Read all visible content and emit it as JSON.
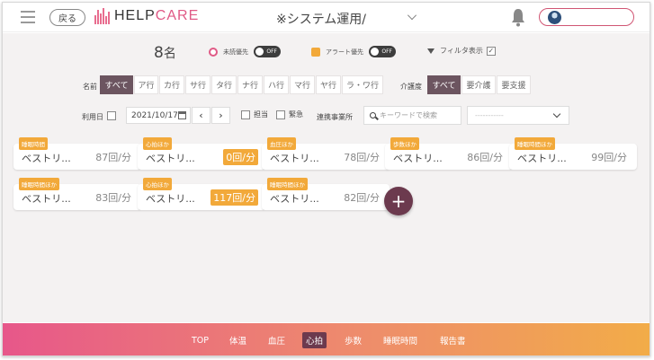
{
  "header": {
    "back_label": "戻る",
    "logo_text_1": "HELP",
    "logo_text_2": "CARE",
    "title": "※システム運用/",
    "menu_icon": "hamburger-menu-icon",
    "bell_icon": "bell-icon",
    "dropdown_icon": "chevron-down-icon"
  },
  "toolbar": {
    "count_number": "8",
    "count_unit": "名",
    "unread_label": "未読優先",
    "unread_toggle": "OFF",
    "alert_label": "アラート優先",
    "alert_toggle": "OFF",
    "filter_label": "フィルタ表示",
    "filter_checked": "✓"
  },
  "filters": {
    "name_label": "名前",
    "name_options": [
      "すべて",
      "ア行",
      "カ行",
      "サ行",
      "タ行",
      "ナ行",
      "ハ行",
      "マ行",
      "ヤ行",
      "ラ・ワ行"
    ],
    "care_label": "介護度",
    "care_options": [
      "すべて",
      "要介護",
      "要支援"
    ],
    "usage_label": "利用日",
    "date_value": "2021/10/17",
    "prev_label": "‹",
    "next_label": "›",
    "assigned_label": "担当",
    "urgent_label": "緊急",
    "office_label": "連携事業所",
    "search_placeholder": "キーワードで検索",
    "select_value": "-----------"
  },
  "cards": [
    {
      "tag": "睡眠時間",
      "name": "ベストリ...",
      "value": "87回/分",
      "alert": false
    },
    {
      "tag": "心拍ほか",
      "name": "ベストリ...",
      "value": "0回/分",
      "alert": true
    },
    {
      "tag": "血圧ほか",
      "name": "ベストリ...",
      "value": "78回/分",
      "alert": false
    },
    {
      "tag": "歩数ほか",
      "name": "ベストリ...",
      "value": "86回/分",
      "alert": false
    },
    {
      "tag": "睡眠時間ほか",
      "name": "ベストリ...",
      "value": "99回/分",
      "alert": false
    },
    {
      "tag": "睡眠時間ほか",
      "name": "ベストリ...",
      "value": "83回/分",
      "alert": false
    },
    {
      "tag": "心拍ほか",
      "name": "ベストリ...",
      "value": "117回/分",
      "alert": true
    },
    {
      "tag": "睡眠時間ほか",
      "name": "ベストリ...",
      "value": "82回/分",
      "alert": false
    }
  ],
  "add_label": "+",
  "footer": {
    "items": [
      "TOP",
      "体温",
      "血圧",
      "心拍",
      "歩数",
      "睡眠時間",
      "報告書"
    ],
    "active": "心拍"
  },
  "colors": {
    "accent": "#6c5560",
    "alert": "#f2a93a",
    "pink": "#e05a86"
  }
}
